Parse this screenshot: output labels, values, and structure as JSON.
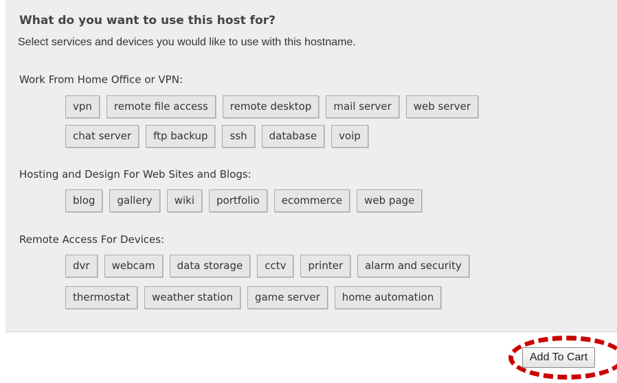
{
  "header": {
    "title": "What do you want to use this host for?",
    "subtitle": "Select services and devices you would like to use with this hostname."
  },
  "sections": [
    {
      "label": "Work From Home Office or VPN:",
      "rows": [
        [
          "vpn",
          "remote file access",
          "remote desktop",
          "mail server",
          "web server"
        ],
        [
          "chat server",
          "ftp backup",
          "ssh",
          "database",
          "voip"
        ]
      ]
    },
    {
      "label": "Hosting and Design For Web Sites and Blogs:",
      "rows": [
        [
          "blog",
          "gallery",
          "wiki",
          "portfolio",
          "ecommerce",
          "web page"
        ]
      ]
    },
    {
      "label": "Remote Access For Devices:",
      "rows": [
        [
          "dvr",
          "webcam",
          "data storage",
          "cctv",
          "printer",
          "alarm and security"
        ],
        [
          "thermostat",
          "weather station",
          "game server",
          "home automation"
        ]
      ]
    }
  ],
  "actions": {
    "add_to_cart_label": "Add To Cart"
  },
  "colors": {
    "highlight_ring": "#cc0000",
    "panel_background": "#eeeeee"
  }
}
